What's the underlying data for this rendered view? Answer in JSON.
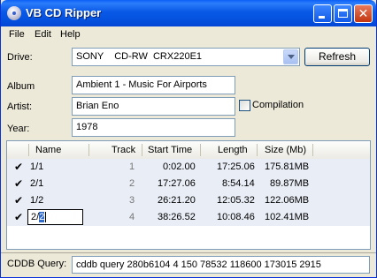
{
  "window": {
    "title": "VB CD Ripper"
  },
  "titlebar_buttons": {
    "minimize": "minimize-icon",
    "maximize": "maximize-icon",
    "close": "close-icon"
  },
  "menu": {
    "file": "File",
    "edit": "Edit",
    "help": "Help"
  },
  "drive": {
    "label": "Drive:",
    "value": "SONY    CD-RW  CRX220E1",
    "refresh_label": "Refresh"
  },
  "album": {
    "label": "Album",
    "value": "Ambient 1 - Music For Airports"
  },
  "artist": {
    "label": "Artist:",
    "value": "Brian Eno",
    "compilation_label": "Compilation",
    "compilation_checked": false
  },
  "year": {
    "label": "Year:",
    "value": "1978"
  },
  "grid": {
    "columns": [
      "Name",
      "Track",
      "Start Time",
      "Length",
      "Size (Mb)"
    ],
    "rows": [
      {
        "checked": true,
        "name": "1/1",
        "track": "1",
        "start": "0:02.00",
        "length": "17:25.06",
        "size": "175.81MB"
      },
      {
        "checked": true,
        "name": "2/1",
        "track": "2",
        "start": "17:27.06",
        "length": "8:54.14",
        "size": "89.87MB"
      },
      {
        "checked": true,
        "name": "1/2",
        "track": "3",
        "start": "26:21.20",
        "length": "12:05.32",
        "size": "122.06MB"
      },
      {
        "checked": true,
        "name_prefix": "2/",
        "name_selected": "2",
        "track": "4",
        "start": "38:26.52",
        "length": "10:08.46",
        "size": "102.41MB"
      }
    ]
  },
  "cddb": {
    "label": "CDDB Query:",
    "value": "cddb query 280b6104 4 150 78532 118600 173015 2915"
  }
}
